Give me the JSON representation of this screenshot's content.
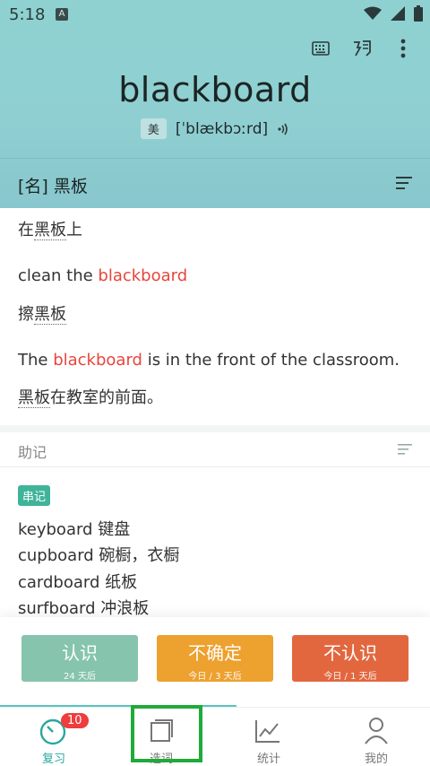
{
  "status_bar": {
    "time": "5:18",
    "a_badge": "A"
  },
  "toolbar": {
    "icons": [
      "keyboard-icon",
      "dictation-icon",
      "more-vert-icon"
    ]
  },
  "word": {
    "title": "blackboard",
    "accent_tag": "美",
    "phonetic": "[ˈblækbɔːrd]",
    "speaker_icon": "speaker-icon"
  },
  "definition": {
    "text": "[名] 黑板"
  },
  "examples": {
    "e0_cn_pre": "在",
    "e0_cn_word": "黑板",
    "e0_cn_post": "上",
    "e1_pre": "clean the ",
    "e1_hl": "blackboard",
    "e1_post": "",
    "e1_cn_pre": "擦",
    "e1_cn_word": "黑板",
    "e1_cn_post": "",
    "e2_pre": "The ",
    "e2_hl": "blackboard",
    "e2_post": " is in the front of the classroom.",
    "e2_cn_pre": "",
    "e2_cn_word": "黑板",
    "e2_cn_post": "在教室的前面。"
  },
  "mnemonic": {
    "title": "助记",
    "tag": "串记",
    "items": [
      "keyboard 键盘",
      "cupboard 碗橱，衣橱",
      "cardboard 纸板",
      "surfboard 冲浪板"
    ]
  },
  "rating": {
    "know": {
      "label": "认识",
      "sub": "24 天后",
      "color": "#86c4ad"
    },
    "unsure": {
      "label": "不确定",
      "sub": "今日 / 3 天后",
      "color": "#eda12e"
    },
    "unknown": {
      "label": "不认识",
      "sub": "今日 / 1 天后",
      "color": "#e2673f"
    }
  },
  "tabs": [
    {
      "label": "复习",
      "badge": "10"
    },
    {
      "label": "选词"
    },
    {
      "label": "统计"
    },
    {
      "label": "我的"
    }
  ],
  "colors": {
    "accent": "#2aa89f",
    "highlight": "#e8453c",
    "selection": "#1faa3a"
  }
}
